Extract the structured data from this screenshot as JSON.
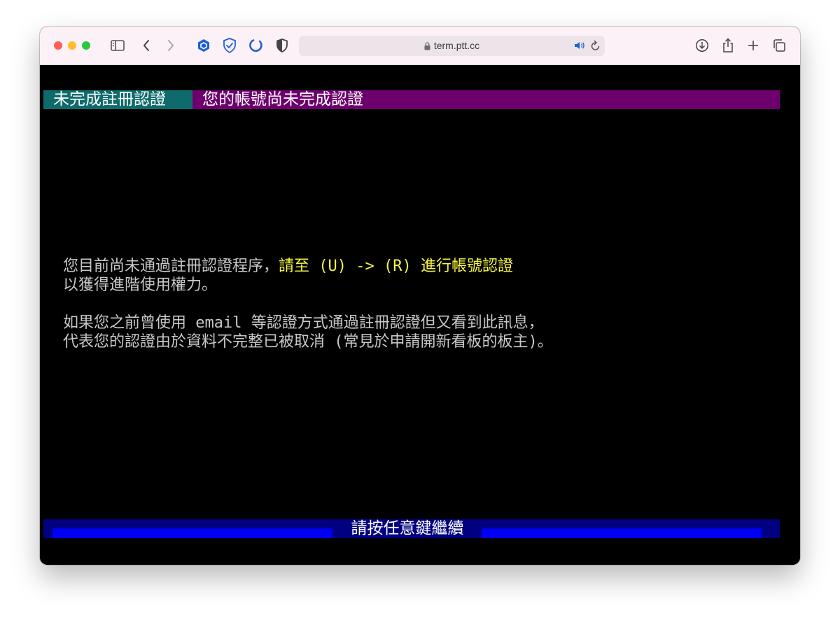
{
  "browser": {
    "address": "term.ptt.cc"
  },
  "terminal": {
    "status_tag": "未完成註冊認證",
    "status_message": "您的帳號尚未完成認證",
    "line1_part1": "您目前尚未通過註冊認證程序，",
    "line1_highlight": "請至 (U) -> (R) 進行帳號認證",
    "line2": "以獲得進階使用權力。",
    "line3": "如果您之前曾使用 email 等認證方式通過註冊認證但又看到此訊息，",
    "line4": "代表您的認證由於資料不完整已被取消 (常見於申請開新看板的板主)。",
    "press_any_key": "請按任意鍵繼續"
  },
  "colors": {
    "status_tag_bg": "#0f6b6b",
    "status_bar_bg": "#6e006e",
    "highlight_text": "#f5f542",
    "bottom_bar_bg": "#000080",
    "bottom_stripe": "#0000f5"
  }
}
